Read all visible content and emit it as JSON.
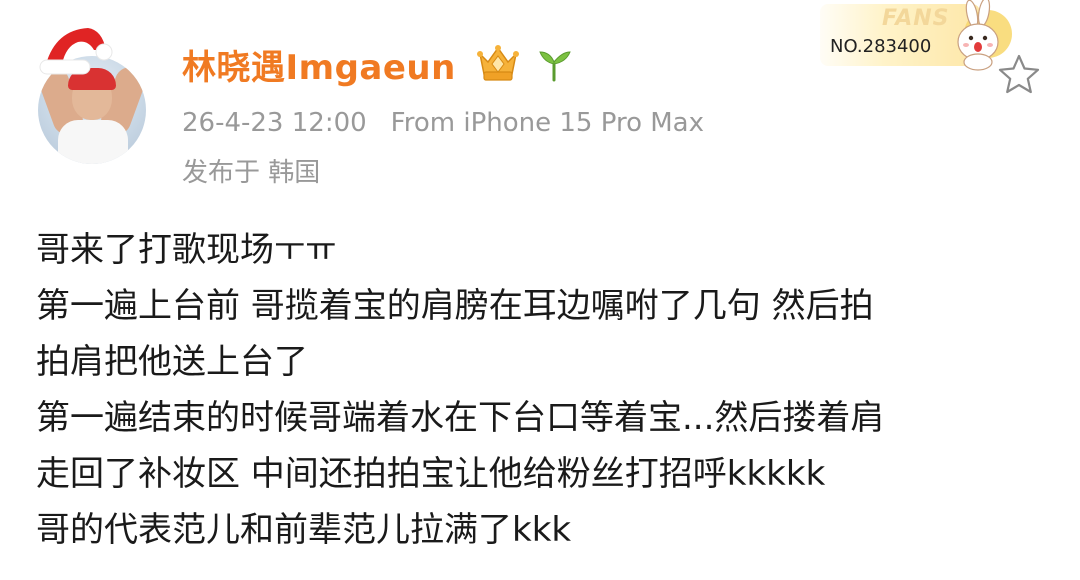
{
  "header": {
    "username": "林晓遇Imgaeun",
    "timestamp": "26-4-23 12:00",
    "source": "From iPhone 15 Pro Max",
    "location": "发布于 韩国"
  },
  "fans_badge": {
    "title": "FANS",
    "number": "NO.283400"
  },
  "icons": {
    "santa_hat": "santa-hat-icon",
    "vip": "vip-crown-badge-icon",
    "sprout": "sprout-icon",
    "mascot": "rabbit-mascot-icon",
    "favorite": "star-icon"
  },
  "colors": {
    "username": "#f07a22",
    "meta": "#999999",
    "text": "#1a1a1a",
    "fans_gold": "#f3d79a"
  },
  "post": {
    "lines": [
      "哥来了打歌现场ㅜㅠ",
      "第一遍上台前 哥揽着宝的肩膀在耳边嘱咐了几句 然后拍",
      "拍肩把他送上台了",
      "第一遍结束的时候哥端着水在下台口等着宝...然后搂着肩",
      "走回了补妆区 中间还拍拍宝让他给粉丝打招呼kkkkk",
      "哥的代表范儿和前辈范儿拉满了kkk"
    ]
  }
}
